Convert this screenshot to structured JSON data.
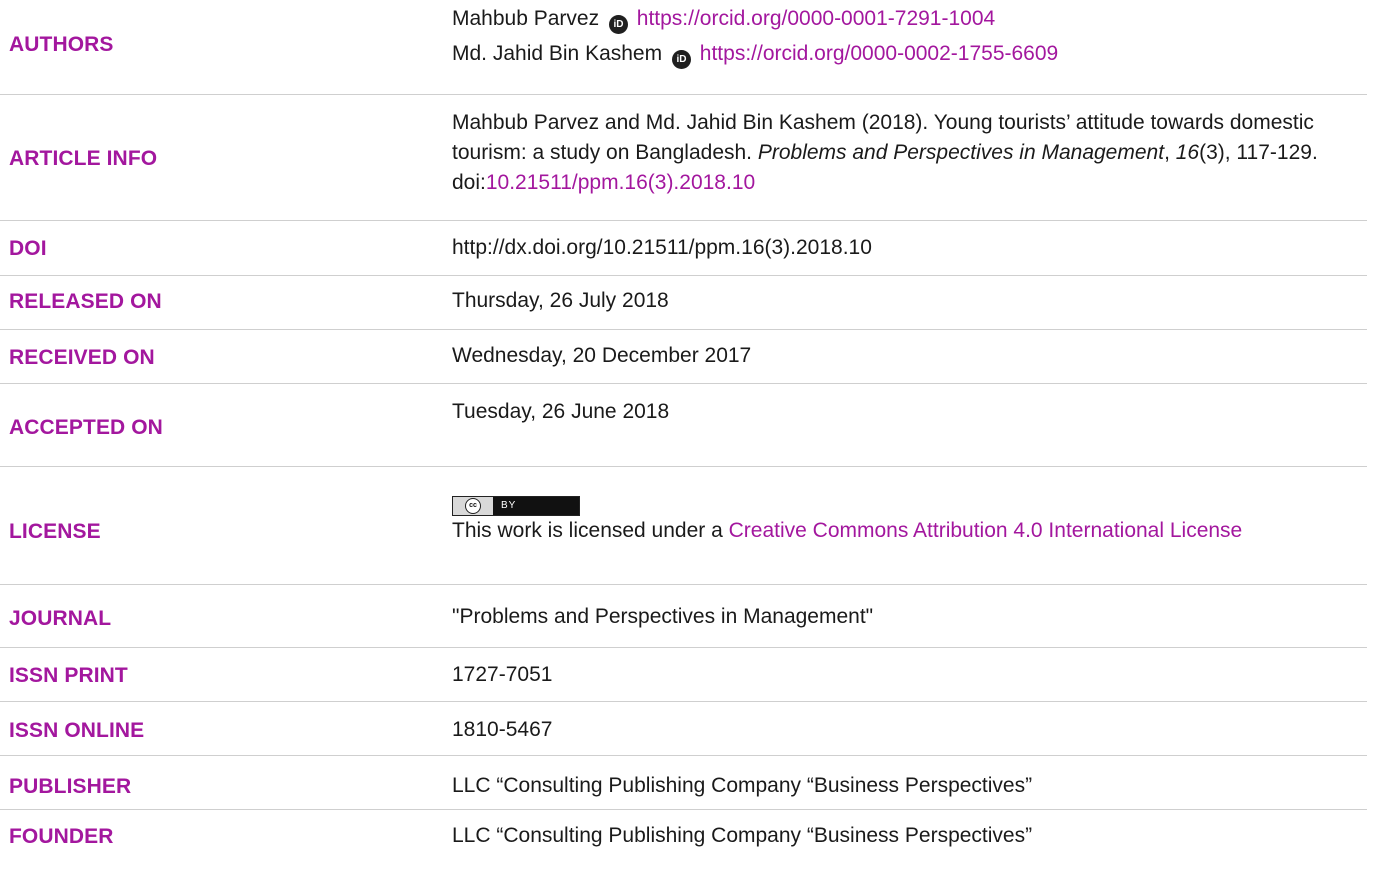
{
  "labels": {
    "authors": "AUTHORS",
    "article_info": "ARTICLE INFO",
    "doi": "DOI",
    "released_on": "RELEASED ON",
    "received_on": "RECEIVED ON",
    "accepted_on": "ACCEPTED ON",
    "license": "LICENSE",
    "journal": "JOURNAL",
    "issn_print": "ISSN PRINT",
    "issn_online": "ISSN ONLINE",
    "publisher": "PUBLISHER",
    "founder": "FOUNDER"
  },
  "authors": [
    {
      "name": "Mahbub Parvez",
      "orcid_badge": "iD",
      "orcid_url": "https://orcid.org/0000-0001-7291-1004"
    },
    {
      "name": "Md. Jahid Bin Kashem",
      "orcid_badge": "iD",
      "orcid_url": "https://orcid.org/0000-0002-1755-6609"
    }
  ],
  "article_info": {
    "authors_year": "Mahbub Parvez and Md. Jahid Bin Kashem (2018). ",
    "title": "Young tourists’ attitude towards domestic tourism: a study on Bangladesh. ",
    "journal": "Problems and Perspectives in Management",
    "sep": ", ",
    "volume": "16",
    "issue_pages": "(3), 117-129. doi:",
    "doi_link": "10.21511/ppm.16(3).2018.10"
  },
  "doi": "http://dx.doi.org/10.21511/ppm.16(3).2018.10",
  "released_on": "Thursday, 26 July 2018",
  "received_on": "Wednesday, 20 December 2017",
  "accepted_on": "Tuesday, 26 June 2018",
  "license": {
    "badge_cc": "cc",
    "badge_by": "BY",
    "text": "This work is licensed under a ",
    "link": "Creative Commons Attribution 4.0 International License"
  },
  "journal": "\"Problems and Perspectives in Management\"",
  "issn_print": "1727-7051",
  "issn_online": "1810-5467",
  "publisher": "LLC “Consulting Publishing Company “Business Perspectives”",
  "founder": "LLC “Consulting Publishing Company “Business Perspectives”",
  "colors": {
    "accent": "#a3179e",
    "text": "#1a1a1a",
    "divider": "#cfcfcf"
  }
}
